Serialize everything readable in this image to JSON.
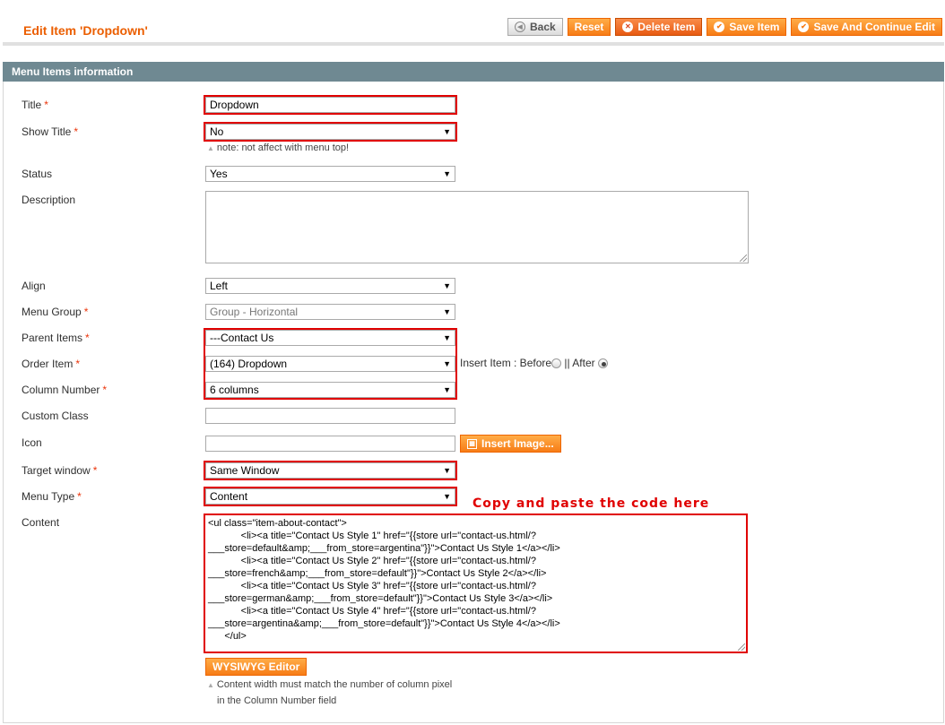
{
  "header": {
    "title": "Edit Item 'Dropdown'",
    "buttons": {
      "back": "Back",
      "reset": "Reset",
      "delete": "Delete Item",
      "save": "Save Item",
      "save_continue": "Save And Continue Edit"
    }
  },
  "section": {
    "title": "Menu Items information"
  },
  "fields": {
    "title": {
      "label": "Title",
      "value": "Dropdown"
    },
    "show_title": {
      "label": "Show Title",
      "value": "No",
      "note": "note: not affect with menu top!"
    },
    "status": {
      "label": "Status",
      "value": "Yes"
    },
    "description": {
      "label": "Description",
      "value": ""
    },
    "align": {
      "label": "Align",
      "value": "Left"
    },
    "menu_group": {
      "label": "Menu Group",
      "value": "Group - Horizontal"
    },
    "parent_items": {
      "label": "Parent Items",
      "value": "---Contact Us"
    },
    "order_item": {
      "label": "Order Item",
      "value": "(164) Dropdown",
      "insert_label": "Insert Item : Before",
      "after_label": "|| After"
    },
    "column_number": {
      "label": "Column Number",
      "value": "6 columns"
    },
    "custom_class": {
      "label": "Custom Class",
      "value": ""
    },
    "icon": {
      "label": "Icon",
      "value": "",
      "button": "Insert Image..."
    },
    "target_window": {
      "label": "Target window",
      "value": "Same Window"
    },
    "menu_type": {
      "label": "Menu Type",
      "value": "Content"
    },
    "content": {
      "label": "Content",
      "lines": [
        "<ul class=\"item-about-contact\">",
        "            <li><a title=\"Contact Us Style 1\" href=\"{{store url=\"contact-us.html/?",
        "___store=default&amp;___from_store=argentina\"}}\">Contact Us Style 1</a></li>",
        "            <li><a title=\"Contact Us Style 2\" href=\"{{store url=\"contact-us.html/?",
        "___store=french&amp;___from_store=default\"}}\">Contact Us Style 2</a></li>",
        "            <li><a title=\"Contact Us Style 3\" href=\"{{store url=\"contact-us.html/?",
        "___store=german&amp;___from_store=default\"}}\">Contact Us Style 3</a></li>",
        "            <li><a title=\"Contact Us Style 4\" href=\"{{store url=\"contact-us.html/?",
        "___store=argentina&amp;___from_store=default\"}}\">Contact Us Style 4</a></li>",
        "      </ul>"
      ],
      "wysiwyg_button": "WYSIWYG Editor",
      "note_line1": "Content width must match the number of column pixel",
      "note_line2": "in the Column Number field"
    }
  },
  "annotation": "Copy and paste the code here",
  "colors": {
    "accent": "#eb5e00",
    "highlight": "#e00000",
    "section_header": "#6f8992"
  }
}
